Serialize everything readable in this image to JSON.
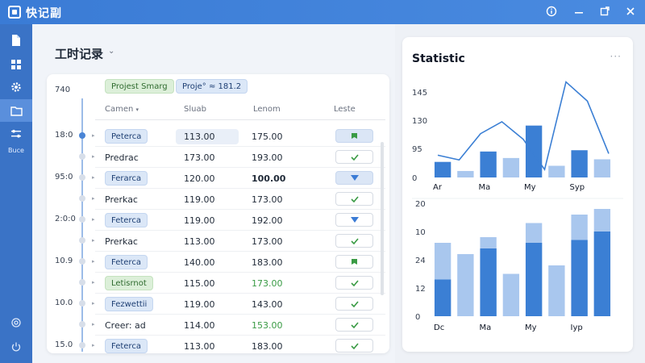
{
  "app": {
    "title": "快记副"
  },
  "sidebar": {
    "label": "Buce"
  },
  "main": {
    "title": "工时记录",
    "tags": [
      "Projest Smarg",
      "Proje° ≈ 181.2"
    ],
    "first_time": "740",
    "columns": [
      "Camen",
      "Sluab",
      "Lenom",
      "Leste"
    ],
    "rows": [
      {
        "time": "18:0",
        "name": "Peterca",
        "pill": "blue",
        "v1": "113.00",
        "v2": "175.00",
        "status": "flag",
        "dot": "active",
        "hl": true
      },
      {
        "time": "",
        "name": "Predrac",
        "pill": "",
        "v1": "173.00",
        "v2": "193.00",
        "status": "check",
        "dot": ""
      },
      {
        "time": "95:0",
        "name": "Ferarca",
        "pill": "blue",
        "v1": "120.00",
        "v2": "100.00",
        "status": "down",
        "dot": "",
        "bold2": true
      },
      {
        "time": "",
        "name": "Prerkac",
        "pill": "",
        "v1": "119.00",
        "v2": "173.00",
        "status": "check",
        "dot": ""
      },
      {
        "time": "2:0:0",
        "name": "Feterca",
        "pill": "blue",
        "v1": "119.00",
        "v2": "192.00",
        "status": "down-plain",
        "dot": ""
      },
      {
        "time": "",
        "name": "Prerkac",
        "pill": "",
        "v1": "113.00",
        "v2": "173.00",
        "status": "check",
        "dot": ""
      },
      {
        "time": "10.9",
        "name": "Feterca",
        "pill": "blue",
        "v1": "140.00",
        "v2": "183.00",
        "status": "flag",
        "dot": ""
      },
      {
        "time": "",
        "name": "Letisrnot",
        "pill": "green",
        "v1": "115.00",
        "v2": "173.00",
        "status": "check",
        "dot": "",
        "green2": true
      },
      {
        "time": "10.0",
        "name": "Fezwettii",
        "pill": "blue",
        "v1": "119.00",
        "v2": "143.00",
        "status": "check",
        "dot": ""
      },
      {
        "time": "",
        "name": "Creer: ad",
        "pill": "",
        "v1": "114.00",
        "v2": "153.00",
        "status": "check",
        "dot": "",
        "green2": true
      },
      {
        "time": "15.0",
        "name": "Feterca",
        "pill": "blue",
        "v1": "113.00",
        "v2": "183.00",
        "status": "check",
        "dot": ""
      }
    ]
  },
  "statistic": {
    "title": "Statistic",
    "more": "···"
  },
  "chart_data": [
    {
      "type": "bar",
      "categories": [
        "Ar",
        "Ma",
        "My",
        "Syp"
      ],
      "yticks": [
        "145",
        "130",
        "95",
        "0"
      ],
      "ylim": [
        0,
        145
      ],
      "bars": [
        12,
        5,
        20,
        15,
        40,
        9,
        21,
        14
      ],
      "line": [
        28,
        22,
        55,
        70,
        48,
        10,
        120,
        96,
        30
      ],
      "xlabels_at": [
        0,
        2,
        4,
        6
      ]
    },
    {
      "type": "bar",
      "categories": [
        "Dc",
        "Ma",
        "My",
        "Iyp"
      ],
      "yticks": [
        "20",
        "10",
        "24",
        "12",
        "0"
      ],
      "ylim": [
        0,
        40
      ],
      "series": [
        {
          "name": "light",
          "values": [
            26,
            22,
            28,
            15,
            33,
            18,
            36,
            38
          ]
        },
        {
          "name": "dark",
          "values": [
            13,
            0,
            24,
            0,
            26,
            0,
            27,
            30
          ]
        }
      ]
    }
  ],
  "colors": {
    "accent": "#3a7bd5",
    "bar_dark": "#3b7fd4",
    "bar_light": "#a9c7ee",
    "green": "#3a9b45"
  }
}
